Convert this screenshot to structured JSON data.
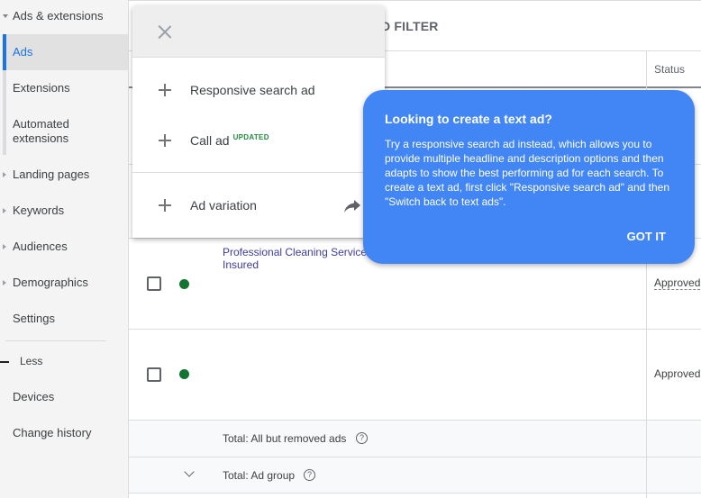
{
  "sidebar": {
    "section": "Ads & extensions",
    "items": [
      {
        "label": "Ads",
        "active": true
      },
      {
        "label": "Extensions"
      },
      {
        "label": "Automated extensions"
      },
      {
        "label": "Landing pages"
      },
      {
        "label": "Keywords"
      },
      {
        "label": "Audiences"
      },
      {
        "label": "Demographics"
      },
      {
        "label": "Settings"
      }
    ],
    "less_label": "Less",
    "extra_items": [
      {
        "label": "Devices"
      },
      {
        "label": "Change history"
      }
    ]
  },
  "toolbar": {
    "filter_label": "ADD FILTER",
    "filter_visible": "D FILTER"
  },
  "table": {
    "columns": {
      "status": "Status"
    },
    "rows": [
      {
        "ad_text": "Professional Cleaning Service Insured",
        "status": "Approved",
        "status_dotted": true
      },
      {
        "ad_text": "",
        "status": "Approved"
      }
    ],
    "totals": [
      {
        "label": "Total: All but removed ads"
      },
      {
        "label": "Total: Ad group"
      }
    ]
  },
  "popup_menu": {
    "items": [
      {
        "label": "Responsive search ad"
      },
      {
        "label": "Call ad",
        "badge": "UPDATED"
      },
      {
        "label": "Ad variation"
      }
    ]
  },
  "tooltip": {
    "title": "Looking to create a text ad?",
    "body": "Try a responsive search ad instead, which allows you to provide multiple headline and description options and then adapts to show the best performing ad for each search. To create a text ad, first click \"Responsive search ad\" and then \"Switch back to text ads\".",
    "button": "GOT IT"
  },
  "colors": {
    "accent": "#1a73e8",
    "tooltip": "#4285f4",
    "status_enabled": "#137333",
    "badge": "#1e8e3e"
  }
}
